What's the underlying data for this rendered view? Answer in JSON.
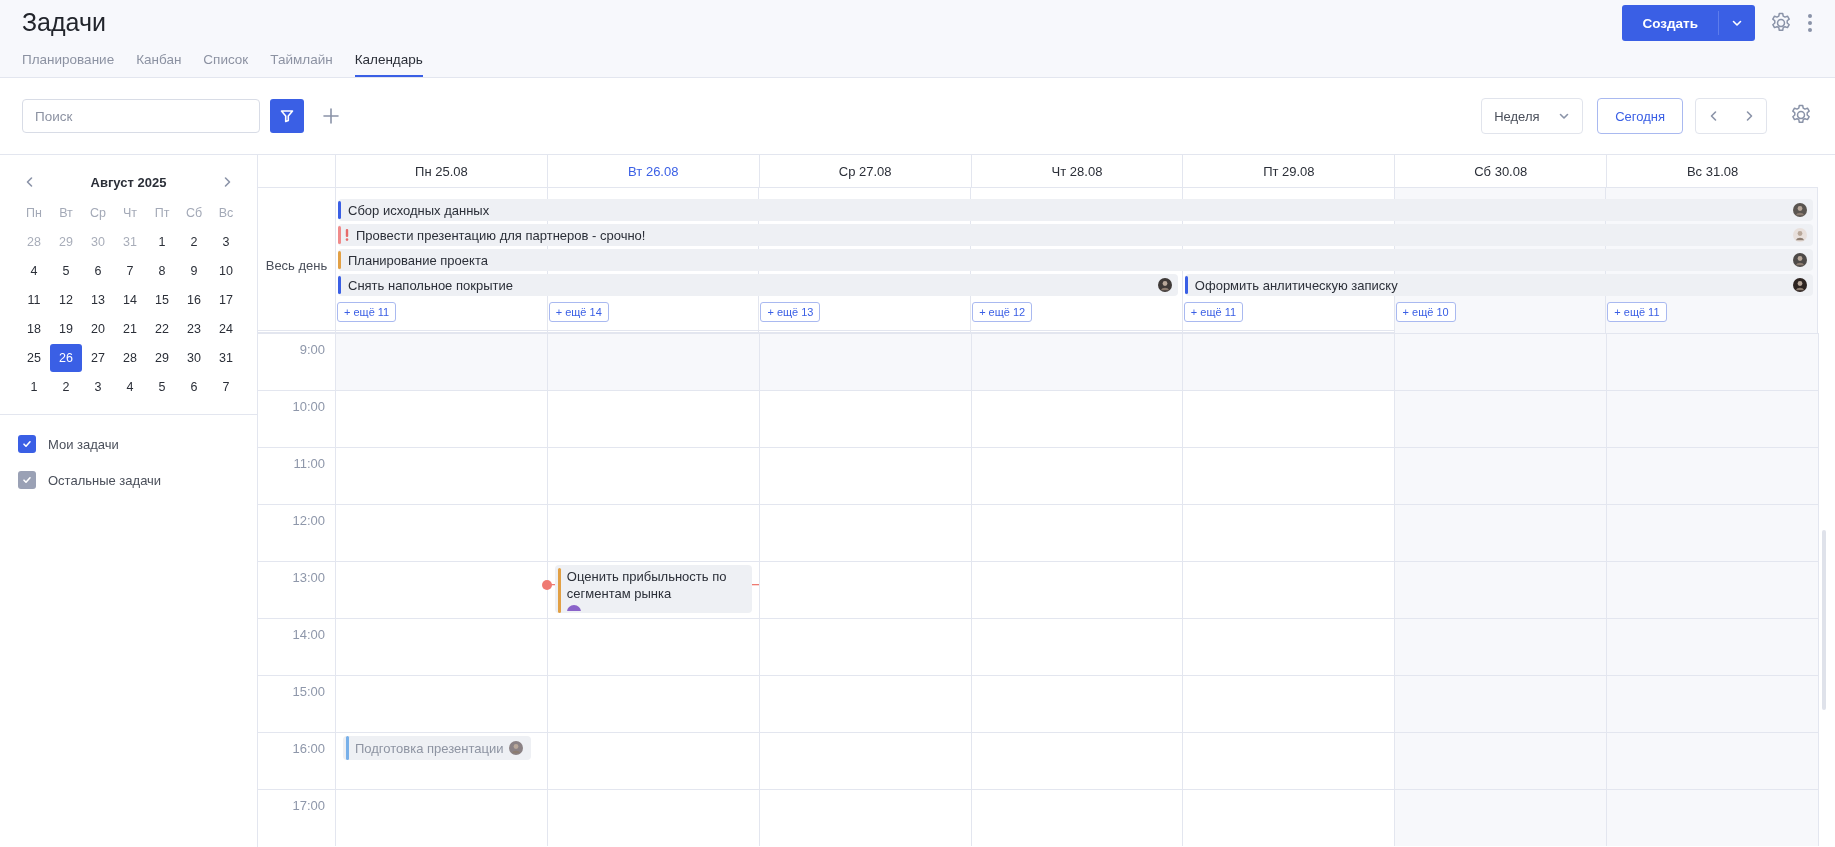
{
  "title": "Задачи",
  "tabs": [
    {
      "label": "Планирование",
      "selected": false
    },
    {
      "label": "Канбан",
      "selected": false
    },
    {
      "label": "Список",
      "selected": false
    },
    {
      "label": "Таймлайн",
      "selected": false
    },
    {
      "label": "Календарь",
      "selected": true
    }
  ],
  "create_button": "Создать",
  "search": {
    "placeholder": "Поиск"
  },
  "view_select": "Неделя",
  "today_button": "Сегодня",
  "mini_calendar": {
    "month": "Август 2025",
    "weekdays": [
      "Пн",
      "Вт",
      "Ср",
      "Чт",
      "Пт",
      "Сб",
      "Вс"
    ],
    "weeks": [
      [
        {
          "d": "28",
          "muted": true,
          "selected": false
        },
        {
          "d": "29",
          "muted": true,
          "selected": false
        },
        {
          "d": "30",
          "muted": true,
          "selected": false
        },
        {
          "d": "31",
          "muted": true,
          "selected": false
        },
        {
          "d": "1",
          "muted": false,
          "selected": false
        },
        {
          "d": "2",
          "muted": false,
          "selected": false
        },
        {
          "d": "3",
          "muted": false,
          "selected": false
        }
      ],
      [
        {
          "d": "4",
          "muted": false,
          "selected": false
        },
        {
          "d": "5",
          "muted": false,
          "selected": false
        },
        {
          "d": "6",
          "muted": false,
          "selected": false
        },
        {
          "d": "7",
          "muted": false,
          "selected": false
        },
        {
          "d": "8",
          "muted": false,
          "selected": false
        },
        {
          "d": "9",
          "muted": false,
          "selected": false
        },
        {
          "d": "10",
          "muted": false,
          "selected": false
        }
      ],
      [
        {
          "d": "11",
          "muted": false,
          "selected": false
        },
        {
          "d": "12",
          "muted": false,
          "selected": false
        },
        {
          "d": "13",
          "muted": false,
          "selected": false
        },
        {
          "d": "14",
          "muted": false,
          "selected": false
        },
        {
          "d": "15",
          "muted": false,
          "selected": false
        },
        {
          "d": "16",
          "muted": false,
          "selected": false
        },
        {
          "d": "17",
          "muted": false,
          "selected": false
        }
      ],
      [
        {
          "d": "18",
          "muted": false,
          "selected": false
        },
        {
          "d": "19",
          "muted": false,
          "selected": false
        },
        {
          "d": "20",
          "muted": false,
          "selected": false
        },
        {
          "d": "21",
          "muted": false,
          "selected": false
        },
        {
          "d": "22",
          "muted": false,
          "selected": false
        },
        {
          "d": "23",
          "muted": false,
          "selected": false
        },
        {
          "d": "24",
          "muted": false,
          "selected": false
        }
      ],
      [
        {
          "d": "25",
          "muted": false,
          "selected": false
        },
        {
          "d": "26",
          "muted": false,
          "selected": true
        },
        {
          "d": "27",
          "muted": false,
          "selected": false
        },
        {
          "d": "28",
          "muted": false,
          "selected": false
        },
        {
          "d": "29",
          "muted": false,
          "selected": false
        },
        {
          "d": "30",
          "muted": false,
          "selected": false
        },
        {
          "d": "31",
          "muted": false,
          "selected": false
        }
      ],
      [
        {
          "d": "1",
          "muted": false,
          "selected": false
        },
        {
          "d": "2",
          "muted": false,
          "selected": false
        },
        {
          "d": "3",
          "muted": false,
          "selected": false
        },
        {
          "d": "4",
          "muted": false,
          "selected": false
        },
        {
          "d": "5",
          "muted": false,
          "selected": false
        },
        {
          "d": "6",
          "muted": false,
          "selected": false
        },
        {
          "d": "7",
          "muted": false,
          "selected": false
        }
      ]
    ]
  },
  "filters": [
    {
      "label": "Мои задачи",
      "checked": true,
      "color": "#3a5fe5"
    },
    {
      "label": "Остальные задачи",
      "checked": true,
      "color": "#9aa1b5"
    }
  ],
  "days": [
    {
      "label": "Пн 25.08",
      "today": false,
      "weekend": false,
      "more": "+ ещё 11"
    },
    {
      "label": "Вт 26.08",
      "today": true,
      "weekend": false,
      "more": "+ ещё 14"
    },
    {
      "label": "Ср 27.08",
      "today": false,
      "weekend": false,
      "more": "+ ещё 13"
    },
    {
      "label": "Чт 28.08",
      "today": false,
      "weekend": false,
      "more": "+ ещё 12"
    },
    {
      "label": "Пт 29.08",
      "today": false,
      "weekend": false,
      "more": "+ ещё 11"
    },
    {
      "label": "Сб 30.08",
      "today": false,
      "weekend": true,
      "more": "+ ещё 10"
    },
    {
      "label": "Вс 31.08",
      "today": false,
      "weekend": true,
      "more": "+ ещё 11"
    }
  ],
  "all_day": {
    "label": "Весь день",
    "rows": [
      {
        "events": [
          {
            "title": "Сбор исходных данных",
            "color": "#3a5fe5",
            "urgent": false
          }
        ]
      },
      {
        "events": [
          {
            "title": "Провести презентацию для партнеров - срочно!",
            "color": "#f08a8a",
            "urgent": true
          }
        ]
      },
      {
        "events": [
          {
            "title": "Планирование проекта",
            "color": "#e2a045",
            "urgent": false
          }
        ]
      },
      {
        "events": [
          {
            "title": "Снять напольное покрытие",
            "color": "#3a5fe5",
            "urgent": false
          },
          {
            "title": "Оформить анлитическую записку",
            "color": "#3a5fe5",
            "urgent": false
          }
        ]
      }
    ]
  },
  "hours": [
    "9:00",
    "10:00",
    "11:00",
    "12:00",
    "13:00",
    "14:00",
    "15:00",
    "16:00",
    "17:00"
  ],
  "timed_events": [
    {
      "title": "Оценить прибыльность по сегментам рынка",
      "color": "#e2a045",
      "dimmed": false
    },
    {
      "title": "Подготовка презентации",
      "color": "#6aa8e8",
      "dimmed": true
    }
  ]
}
